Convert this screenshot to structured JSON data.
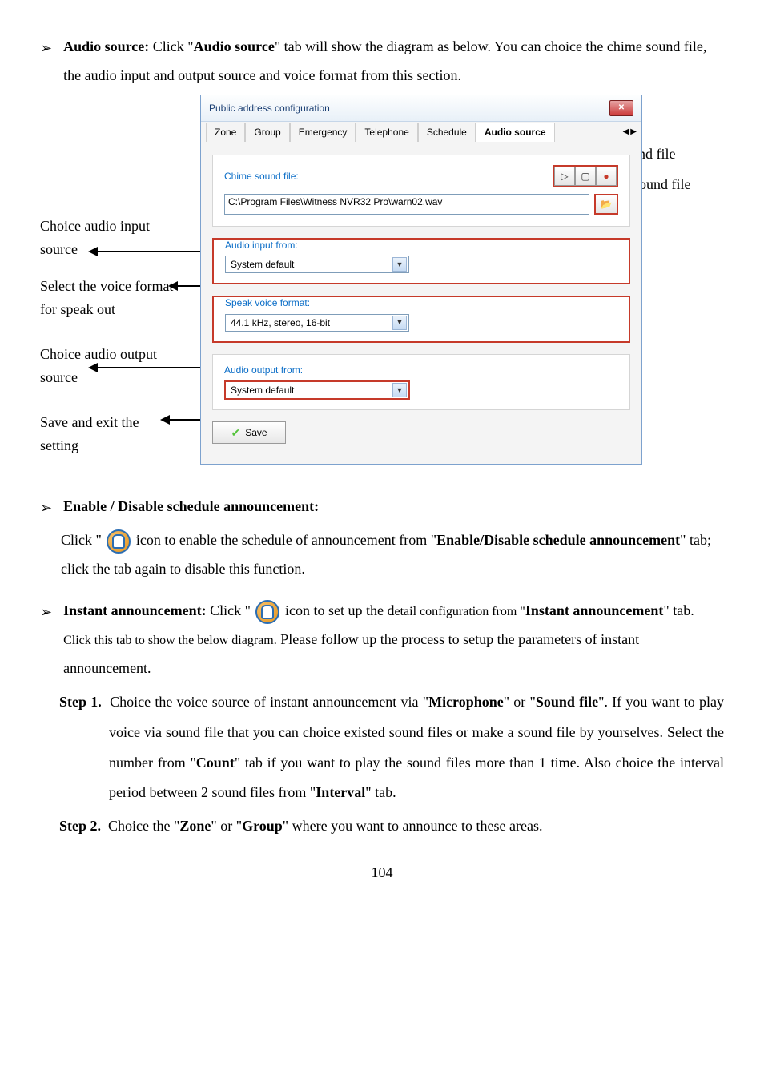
{
  "section1": {
    "title": "Audio source:",
    "body_a": " Click \"",
    "body_b": "Audio source",
    "body_c": "\" tab will show the diagram as below.   You can choice the chime sound file, the audio input and output source and voice format from this section."
  },
  "left_labels": {
    "audio_input": "Choice audio input source",
    "voice_format": "Select the voice format for speak out",
    "audio_output": "Choice audio output source",
    "save": "Save and exit the setting"
  },
  "right_labels": {
    "record_play": "Record/Play chime sound file",
    "browse": "Browse/select existed sound file"
  },
  "dialog": {
    "title": "Public address configuration",
    "tabs": {
      "zone": "Zone",
      "group": "Group",
      "emergency": "Emergency",
      "telephone": "Telephone",
      "schedule": "Schedule",
      "audio_source": "Audio source"
    },
    "chime_label": "Chime sound file:",
    "chime_path": "C:\\Program Files\\Witness NVR32 Pro\\warn02.wav",
    "audio_input_label": "Audio input from:",
    "audio_input_value": "System default",
    "speak_label": "Speak voice format:",
    "speak_value": "44.1 kHz, stereo, 16-bit",
    "audio_output_label": "Audio output from:",
    "audio_output_value": "System default",
    "save": "Save"
  },
  "section2": {
    "title": "Enable / Disable schedule announcement:",
    "line1_a": "Click \" ",
    "line1_b": "icon to enable the schedule of announcement from \"",
    "line1_c": "Enable/Disable schedule announcement",
    "line1_d": "\" tab; click the tab again to disable this function."
  },
  "section3": {
    "title": "Instant announcement:",
    "line1_a": " Click \" ",
    "line1_b": " icon to set up the d",
    "line1_c": "etail configuration from \"",
    "line1_d": "Instant announcement",
    "line1_e": "\" tab.",
    "line1_f": " Click this tab to show the below diagram.",
    "line1_g": "   Please follow up the process to setup the parameters of instant announcement."
  },
  "step1": {
    "label": "Step 1.",
    "a": "Choice the voice source of instant announcement via \"",
    "b": "Microphone",
    "c": "\" or \"",
    "d": "Sound file",
    "e": "\".   If you want to play voice via sound file that you can choice existed sound files or make a sound file by yourselves.     Select the number from \"",
    "f": "Count",
    "g": "\" tab if you want to play the sound files more than 1 time.   Also choice the interval period between 2 sound files from \"",
    "h": "Interval",
    "i": "\" tab."
  },
  "step2": {
    "label": "Step 2.",
    "a": "Choice the \"",
    "b": "Zone",
    "c": "\" or \"",
    "d": "Group",
    "e": "\" where you want to announce to these areas."
  },
  "page_number": "104"
}
